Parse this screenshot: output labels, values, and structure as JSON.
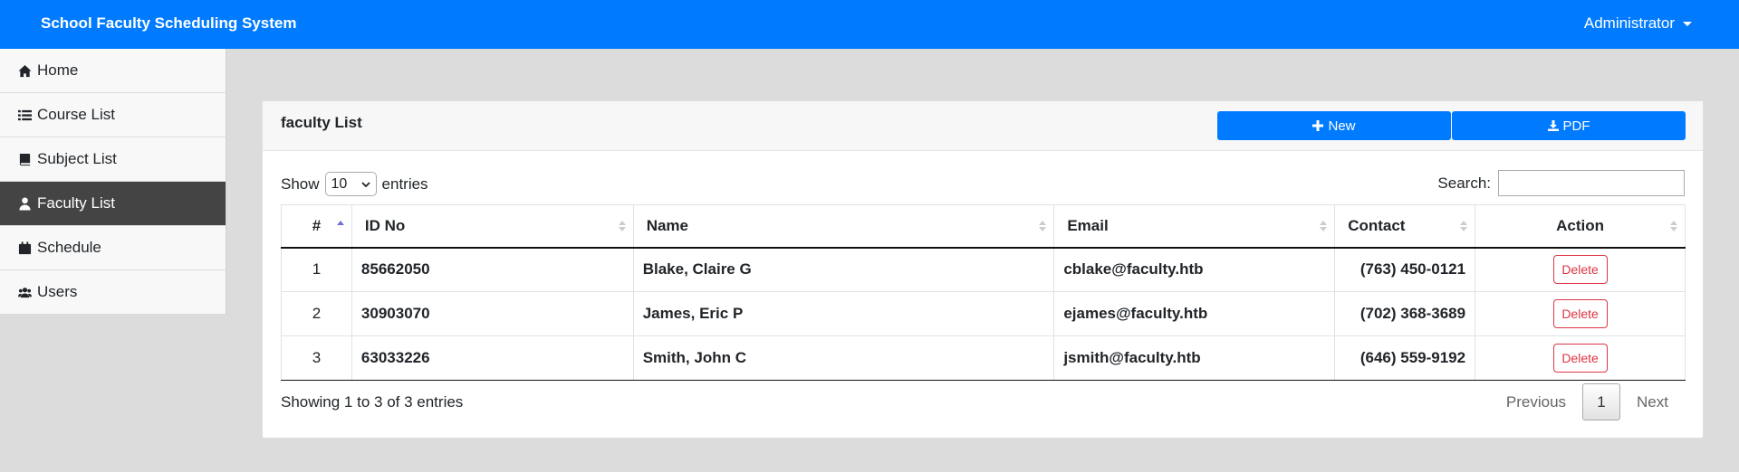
{
  "app": {
    "title": "School Faculty Scheduling System",
    "user_label": "Administrator"
  },
  "sidebar": {
    "items": [
      {
        "label": "Home",
        "icon": "home-icon"
      },
      {
        "label": "Course List",
        "icon": "list-icon"
      },
      {
        "label": "Subject List",
        "icon": "book-icon"
      },
      {
        "label": "Faculty List",
        "icon": "user-tie-icon",
        "active": true
      },
      {
        "label": "Schedule",
        "icon": "calendar-icon"
      },
      {
        "label": "Users",
        "icon": "users-icon"
      }
    ]
  },
  "card": {
    "title": "faculty List",
    "new_label": "New",
    "pdf_label": "PDF"
  },
  "table_controls": {
    "show_label": "Show",
    "page_length": "10",
    "entries_label": "entries",
    "search_label": "Search:",
    "search_value": ""
  },
  "table": {
    "columns": [
      "#",
      "ID No",
      "Name",
      "Email",
      "Contact",
      "Action"
    ],
    "rows": [
      {
        "num": "1",
        "id_no": "85662050",
        "name": "Blake, Claire G",
        "email": "cblake@faculty.htb",
        "contact": "(763) 450-0121",
        "action": "Delete"
      },
      {
        "num": "2",
        "id_no": "30903070",
        "name": "James, Eric P",
        "email": "ejames@faculty.htb",
        "contact": "(702) 368-3689",
        "action": "Delete"
      },
      {
        "num": "3",
        "id_no": "63033226",
        "name": "Smith, John C",
        "email": "jsmith@faculty.htb",
        "contact": "(646) 559-9192",
        "action": "Delete"
      }
    ]
  },
  "footer": {
    "info": "Showing 1 to 3 of 3 entries",
    "previous": "Previous",
    "current_page": "1",
    "next": "Next"
  },
  "colors": {
    "primary": "#007bff",
    "danger": "#dc3545",
    "active_nav": "#444444"
  }
}
